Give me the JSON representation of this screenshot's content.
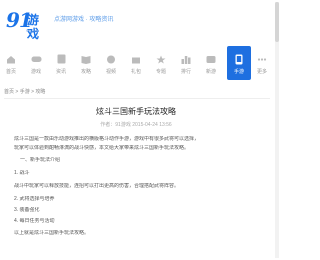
{
  "header": {
    "logo_number": "91",
    "logo_game": "游戏",
    "logo_sub": "91.com",
    "slogan": "点游网游戏 · 攻略资讯"
  },
  "nav": {
    "items": [
      {
        "label": "首页"
      },
      {
        "label": "游戏"
      },
      {
        "label": "资讯"
      },
      {
        "label": "攻略"
      },
      {
        "label": "视频"
      },
      {
        "label": "礼包"
      },
      {
        "label": "专题"
      },
      {
        "label": "排行"
      },
      {
        "label": "新游"
      },
      {
        "label": "手游",
        "active": true
      },
      {
        "label": "更多"
      }
    ]
  },
  "breadcrumb": "首页 > 手游 > 攻略",
  "article": {
    "title": "炫斗三国新手玩法攻略",
    "meta": "作者：91游戏 2015-04-24 13:56",
    "paragraphs": [
      "炫斗三国是一款由乐动游戏推出的横版格斗动作手游，游戏中有很多武将可以选择，",
      "玩家可以体验到酣畅淋漓的战斗快感，本文给大家带来炫斗三国新手玩法攻略。",
      "一、新手玩法介绍",
      "1. 战斗",
      "战斗中玩家可以释放技能，连招可以打出更高的伤害，合理搭配武将阵容。",
      "2. 武将选择与培养",
      "3. 装备强化",
      "4. 每日任务与活动",
      "以上就是炫斗三国新手玩法攻略。"
    ]
  }
}
